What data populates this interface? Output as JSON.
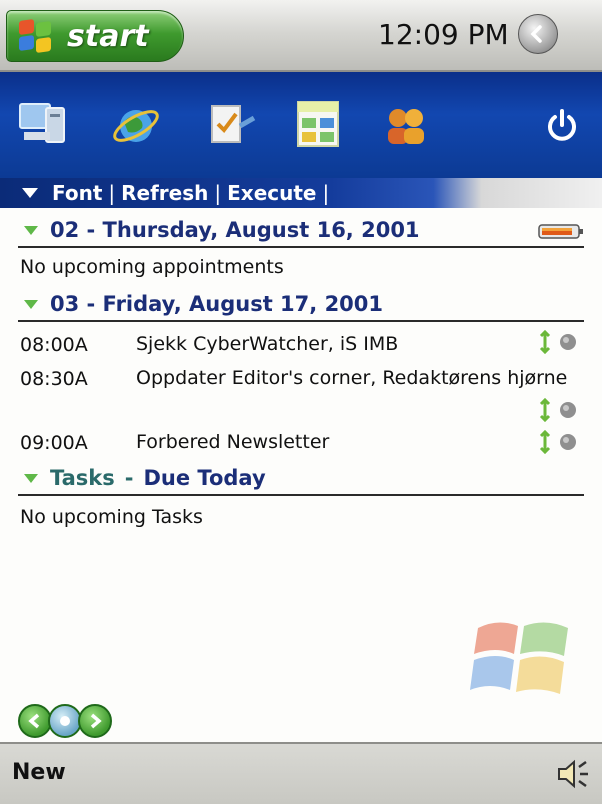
{
  "taskbar": {
    "start_label": "start",
    "clock": "12:09 PM"
  },
  "today_icons": [
    "computer-icon",
    "internet-explorer-icon",
    "tasks-icon",
    "calendar-icon",
    "contacts-icon",
    "power-icon"
  ],
  "menu": {
    "items": [
      "Font",
      "Refresh",
      "Execute"
    ]
  },
  "days": [
    {
      "heading": "02 - Thursday, August 16, 2001",
      "empty_text": "No upcoming appointments"
    },
    {
      "heading": "03 - Friday, August 17, 2001",
      "appointments": [
        {
          "time": "08:00A",
          "text": "Sjekk CyberWatcher, iS IMB"
        },
        {
          "time": "08:30A",
          "text": "Oppdater Editor's corner, Redaktørens hjørne"
        },
        {
          "time": "09:00A",
          "text": "Forbered Newsletter"
        }
      ]
    }
  ],
  "tasks": {
    "heading_prefix": "Tasks",
    "heading_sep": "-",
    "heading_suffix": "Due Today",
    "empty_text": "No upcoming Tasks"
  },
  "bottom": {
    "new_label": "New"
  },
  "colors": {
    "accent_blue": "#1247b0",
    "heading_blue": "#1b2e78",
    "start_green": "#3f9a2e"
  }
}
